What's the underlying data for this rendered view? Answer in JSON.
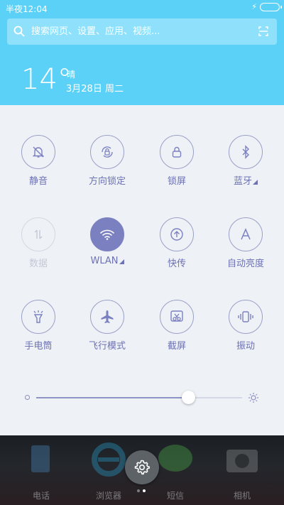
{
  "status_bar": {
    "time": "半夜12:04"
  },
  "search": {
    "placeholder": "搜索网页、设置、应用、视频..."
  },
  "weather": {
    "temperature": "14°",
    "condition": "晴",
    "date": "3月28日 周二"
  },
  "toggles": [
    {
      "label": "静音",
      "icon": "bell-off-icon",
      "active": false,
      "disabled": false
    },
    {
      "label": "方向锁定",
      "icon": "rotation-lock-icon",
      "active": false,
      "disabled": false
    },
    {
      "label": "锁屏",
      "icon": "lock-icon",
      "active": false,
      "disabled": false
    },
    {
      "label": "蓝牙",
      "icon": "bluetooth-icon",
      "active": false,
      "disabled": false,
      "has_menu": true
    },
    {
      "label": "数据",
      "icon": "data-arrows-icon",
      "active": false,
      "disabled": true
    },
    {
      "label": "WLAN",
      "icon": "wifi-icon",
      "active": true,
      "disabled": false,
      "has_menu": true
    },
    {
      "label": "快传",
      "icon": "upload-circle-icon",
      "active": false,
      "disabled": false
    },
    {
      "label": "自动亮度",
      "icon": "auto-brightness-icon",
      "active": false,
      "disabled": false
    },
    {
      "label": "手电筒",
      "icon": "flashlight-icon",
      "active": false,
      "disabled": false
    },
    {
      "label": "飞行模式",
      "icon": "airplane-icon",
      "active": false,
      "disabled": false
    },
    {
      "label": "截屏",
      "icon": "screenshot-icon",
      "active": false,
      "disabled": false
    },
    {
      "label": "振动",
      "icon": "vibrate-icon",
      "active": false,
      "disabled": false
    }
  ],
  "brightness": {
    "level": 0.74
  },
  "dock": {
    "apps": [
      {
        "label": "电话",
        "icon": "phone-icon"
      },
      {
        "label": "浏览器",
        "icon": "browser-icon"
      },
      {
        "label": "短信",
        "icon": "message-icon"
      },
      {
        "label": "相机",
        "icon": "camera-icon"
      }
    ],
    "page_count": 2,
    "current_page": 2
  },
  "colors": {
    "accent": "#7b80c0",
    "header": "#5bd1f7",
    "panel": "#eef1f6"
  }
}
